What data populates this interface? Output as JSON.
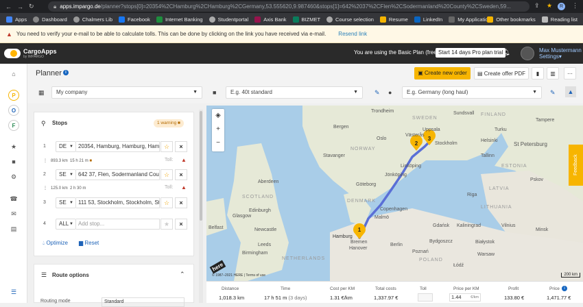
{
  "browser": {
    "url_host": "apps.impargo.de",
    "url_path": "/planner?stops[0]=20354%2CHamburg%2CHamburg%2CGermany,53.555620,9.987460&stops[1]=642%2037%2CFlen%2CSodermanland%20County%2CSweden,59...",
    "profile_initial": "R"
  },
  "bookmarks": {
    "items": [
      "Apps",
      "Dashboard",
      "Chalmers Lib",
      "Facebook",
      "Internet Banking",
      "Studentportal",
      "Axis Bank",
      "BIZMET",
      "Course selection",
      "Resume",
      "LinkedIn",
      "My Application"
    ],
    "other": "Other bookmarks",
    "reading": "Reading list"
  },
  "warning": {
    "text": "You need to verify your e-mail to be able to calculate tolls. This can be done by clicking on the link you have received via e-mail.",
    "link": "Resend link"
  },
  "header": {
    "brand": "CargoApps",
    "brand_sub": "by IMPARGO",
    "plan_text": "You are using the Basic Plan (free)",
    "trial_button": "Start 14 days Pro plan trial",
    "user_name": "Max Mustermann",
    "settings": "Settings"
  },
  "rail": {
    "letters": [
      "P",
      "O",
      "F"
    ]
  },
  "planner": {
    "title": "Planner",
    "info": "i",
    "create_order": "Create new order",
    "create_offer": "Create offer PDF"
  },
  "selects": {
    "company": "My company",
    "vehicle": "E.g. 40t standard",
    "driver": "E.g. Germany (long haul)"
  },
  "stops": {
    "title": "Stops",
    "warning_badge": "1 warning",
    "items": [
      {
        "num": "1",
        "country": "DE",
        "address": "20354, Hamburg, Hamburg, Hamburg"
      },
      {
        "num": "2",
        "country": "SE",
        "address": "642 37, Flen, Sodermanland County, Sweden"
      },
      {
        "num": "3",
        "country": "SE",
        "address": "111 53, Stockholm, Stockholm, Stockholm"
      },
      {
        "num": "4",
        "country": "ALL",
        "address": "Add stop..."
      }
    ],
    "legs": [
      {
        "distance": "893.3 km",
        "time": "15 h 21 m"
      },
      {
        "distance": "125.0 km",
        "time": "2 h 30 m"
      }
    ],
    "toll_label": "Toll:",
    "optimize": "Optimize",
    "reset": "Reset"
  },
  "route_options": {
    "title": "Route options",
    "mode_label": "Routing mode",
    "mode_value": "Standard"
  },
  "map": {
    "labels": {
      "bergen": "Bergen",
      "oslo": "Oslo",
      "stockholm": "Stockholm",
      "finland": "FINLAND",
      "helsinki": "Helsinki",
      "tallinn": "Tallinn",
      "petersburg": "St Petersburg",
      "estonia": "ESTONIA",
      "latvia": "LATVIA",
      "riga": "Riga",
      "lithuania": "LITHUANIA",
      "sweden": "SWEDEN",
      "norway": "NORWAY",
      "denmark": "DENMARK",
      "copenhagen": "Copenhagen",
      "hamburg": "Hamburg",
      "bremen": "Bremen",
      "hanover": "Hanover",
      "berlin": "Berlin",
      "poland": "POLAND",
      "gdansk": "Gdańsk",
      "bydgoszcz": "Bydgoszcz",
      "bialystok": "Białystok",
      "kaliningrad": "Kaliningrad",
      "vilnius": "Vilnius",
      "belfast": "Belfast",
      "scotland": "SCOTLAND",
      "edinburgh": "Edinburgh",
      "glasgow": "Glasgow",
      "newcastle": "Newcastle",
      "leeds": "Leeds",
      "birmingham": "Birmingham",
      "netherlands": "NETHERLANDS",
      "aberdeen": "Aberdeen",
      "goteborg": "Göteborg",
      "malmo": "Malmö",
      "vasteras": "Västerås",
      "uppsala": "Uppsala",
      "linkoping": "Linköping",
      "jonkoping": "Jönköping",
      "trondheim": "Trondheim",
      "lodz": "Łódź",
      "warsaw": "Warsaw",
      "minsk": "Minsk",
      "poznan": "Poznań",
      "pskov": "Pskov",
      "sundsvall": "Sundsvall",
      "tampere": "Tampere",
      "turku": "Turku",
      "stavanger": "Stavanger"
    },
    "markers": [
      "1",
      "2",
      "3"
    ],
    "feedback": "Feedback",
    "scale": "200 km",
    "copyright": "© 1987–2021 HERE | Terms of use",
    "here_logo": "here"
  },
  "summary": {
    "headers": [
      "Distance",
      "Time",
      "Cost per KM",
      "Total costs",
      "Toll",
      "Price per KM",
      "Profit",
      "Price"
    ],
    "distance": "1,018.3 km",
    "time": "17 h 51 m",
    "time_days": "(3 days)",
    "cost_per_km": "1.31 €/km",
    "total_costs": "1,337.97 €",
    "price_per_km": "1.44",
    "price_per_km_unit": "€/km",
    "profit": "133.80 €",
    "price": "1,471.77 €"
  },
  "colors": {
    "accent": "#f7b500",
    "route": "#5a6fd6",
    "link": "#1e63b8",
    "warning_red": "#c0392b"
  }
}
